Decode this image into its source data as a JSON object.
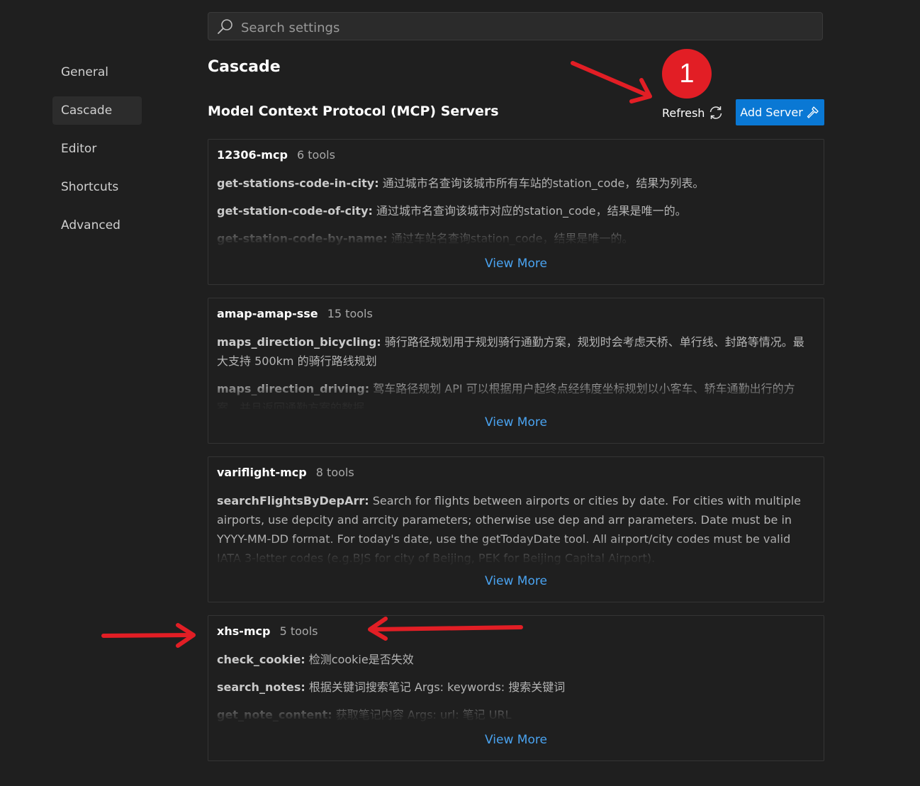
{
  "search": {
    "placeholder": "Search settings"
  },
  "sidebar": {
    "items": [
      {
        "label": "General"
      },
      {
        "label": "Cascade"
      },
      {
        "label": "Editor"
      },
      {
        "label": "Shortcuts"
      },
      {
        "label": "Advanced"
      }
    ],
    "active": "Cascade"
  },
  "main": {
    "title": "Cascade",
    "section_title": "Model Context Protocol (MCP) Servers",
    "refresh_label": "Refresh",
    "add_server_label": "Add Server",
    "view_more_label": "View More"
  },
  "servers": [
    {
      "name": "12306-mcp",
      "tool_count": "6 tools",
      "tools": [
        {
          "name": "get-stations-code-in-city:",
          "desc": " 通过城市名查询该城市所有车站的station_code，结果为列表。"
        },
        {
          "name": "get-station-code-of-city:",
          "desc": " 通过城市名查询该城市对应的station_code，结果是唯一的。"
        },
        {
          "name": "get-station-code-by-name:",
          "desc": " 通过车站名查询station_code，结果是唯一的。"
        }
      ]
    },
    {
      "name": "amap-amap-sse",
      "tool_count": "15 tools",
      "tools": [
        {
          "name": "maps_direction_bicycling:",
          "desc": " 骑行路径规划用于规划骑行通勤方案，规划时会考虑天桥、单行线、封路等情况。最大支持 500km 的骑行路线规划"
        },
        {
          "name": "maps_direction_driving:",
          "desc": " 驾车路径规划 API 可以根据用户起终点经纬度坐标规划以小客车、轿车通勤出行的方案，并且返回通勤方案的数据。"
        }
      ]
    },
    {
      "name": "variflight-mcp",
      "tool_count": "8 tools",
      "tools": [
        {
          "name": "searchFlightsByDepArr:",
          "desc": " Search for flights between airports or cities by date. For cities with multiple airports, use depcity and arrcity parameters; otherwise use dep and arr parameters. Date must be in YYYY-MM-DD format. For today's date, use the getTodayDate tool. All airport/city codes must be valid IATA 3-letter codes (e.g.BJS for city of Beijing, PEK for Beijing Capital Airport)."
        }
      ]
    },
    {
      "name": "xhs-mcp",
      "tool_count": "5 tools",
      "tools": [
        {
          "name": "check_cookie:",
          "desc": " 检测cookie是否失效"
        },
        {
          "name": "search_notes:",
          "desc": " 根据关键词搜索笔记 Args: keywords: 搜索关键词"
        },
        {
          "name": "get_note_content:",
          "desc": " 获取笔记内容 Args: url: 笔记 URL"
        }
      ]
    }
  ],
  "annotation": {
    "badge_number": "1",
    "color": "#e21e25"
  },
  "colors": {
    "accent": "#0a78d4",
    "link": "#4aa3f0",
    "background": "#1f1f1f"
  }
}
